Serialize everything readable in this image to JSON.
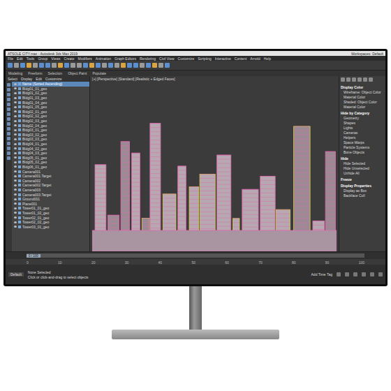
{
  "window": {
    "title": "ATSOLE CITY.max - Autodesk 3ds Max 2019",
    "workspace": "Workspaces: Default"
  },
  "menu": [
    "File",
    "Edit",
    "Tools",
    "Group",
    "Views",
    "Create",
    "Modifiers",
    "Animation",
    "Graph Editors",
    "Rendering",
    "Civil View",
    "Customize",
    "Scripting",
    "Interactive",
    "Content",
    "Arnold",
    "Help"
  ],
  "ribbon": [
    "Modeling",
    "Freeform",
    "Selection",
    "Object Paint",
    "Populate"
  ],
  "scene_explorer": {
    "tabs": [
      "Select",
      "Display",
      "Edit",
      "Customize"
    ],
    "items": [
      {
        "label": "Name (Sorted Ascending)",
        "selected": true
      },
      {
        "label": "Bldg01_01_geo",
        "selected": false
      },
      {
        "label": "Bldg01_02_geo",
        "selected": false
      },
      {
        "label": "Bldg01_03_geo",
        "selected": false
      },
      {
        "label": "Bldg01_04_geo",
        "selected": false
      },
      {
        "label": "Bldg01_05_geo",
        "selected": false
      },
      {
        "label": "Bldg02_01_geo",
        "selected": false
      },
      {
        "label": "Bldg02_02_geo",
        "selected": false
      },
      {
        "label": "Bldg02_03_geo",
        "selected": false
      },
      {
        "label": "Bldg02_04_geo",
        "selected": false
      },
      {
        "label": "Bldg03_01_geo",
        "selected": false
      },
      {
        "label": "Bldg03_02_geo",
        "selected": false
      },
      {
        "label": "Bldg03_03_geo",
        "selected": false
      },
      {
        "label": "Bldg04_01_geo",
        "selected": false
      },
      {
        "label": "Bldg04_02_geo",
        "selected": false
      },
      {
        "label": "Bldg04_03_geo",
        "selected": false
      },
      {
        "label": "Bldg05_01_geo",
        "selected": false
      },
      {
        "label": "Bldg05_02_geo",
        "selected": false
      },
      {
        "label": "Bldg06_01_geo",
        "selected": false
      },
      {
        "label": "Camera001",
        "selected": false
      },
      {
        "label": "Camera001.Target",
        "selected": false
      },
      {
        "label": "Camera002",
        "selected": false
      },
      {
        "label": "Camera002.Target",
        "selected": false
      },
      {
        "label": "Camera003",
        "selected": false
      },
      {
        "label": "Camera003.Target",
        "selected": false
      },
      {
        "label": "Ground001",
        "selected": false
      },
      {
        "label": "Plane001",
        "selected": false
      },
      {
        "label": "Tower01_01_geo",
        "selected": false
      },
      {
        "label": "Tower01_02_geo",
        "selected": false
      },
      {
        "label": "Tower02_01_geo",
        "selected": false
      },
      {
        "label": "Tower02_02_geo",
        "selected": false
      },
      {
        "label": "Tower03_01_geo",
        "selected": false
      }
    ]
  },
  "viewport": {
    "label": "[+] [Perspective] [Standard] [Realistic + Edged Faces]"
  },
  "command_panel": [
    {
      "text": "Display Color",
      "kind": "heading"
    },
    {
      "text": "Wireframe: Object Color",
      "kind": "item"
    },
    {
      "text": "Material Color",
      "kind": "item"
    },
    {
      "text": "Shaded: Object Color",
      "kind": "item"
    },
    {
      "text": "Material Color",
      "kind": "item"
    },
    {
      "text": "Hide by Category",
      "kind": "heading"
    },
    {
      "text": "Geometry",
      "kind": "item"
    },
    {
      "text": "Shapes",
      "kind": "item"
    },
    {
      "text": "Lights",
      "kind": "item"
    },
    {
      "text": "Cameras",
      "kind": "item"
    },
    {
      "text": "Helpers",
      "kind": "item"
    },
    {
      "text": "Space Warps",
      "kind": "item"
    },
    {
      "text": "Particle Systems",
      "kind": "item"
    },
    {
      "text": "Bone Objects",
      "kind": "item"
    },
    {
      "text": "Hide",
      "kind": "heading"
    },
    {
      "text": "Hide Selected",
      "kind": "item"
    },
    {
      "text": "Hide Unselected",
      "kind": "item"
    },
    {
      "text": "Unhide All",
      "kind": "item"
    },
    {
      "text": "Freeze",
      "kind": "heading"
    },
    {
      "text": "Display Properties",
      "kind": "heading"
    },
    {
      "text": "Display as Box",
      "kind": "item"
    },
    {
      "text": "Backface Cull",
      "kind": "item"
    }
  ],
  "timeline": {
    "frame": "0 / 100",
    "ticks": [
      "0",
      "10",
      "20",
      "30",
      "40",
      "50",
      "60",
      "70",
      "80",
      "90",
      "100"
    ]
  },
  "status": {
    "layer": "Default",
    "selection": "None Selected",
    "prompt": "Click or click-and-drag to select objects",
    "tag": "Add Time Tag"
  }
}
